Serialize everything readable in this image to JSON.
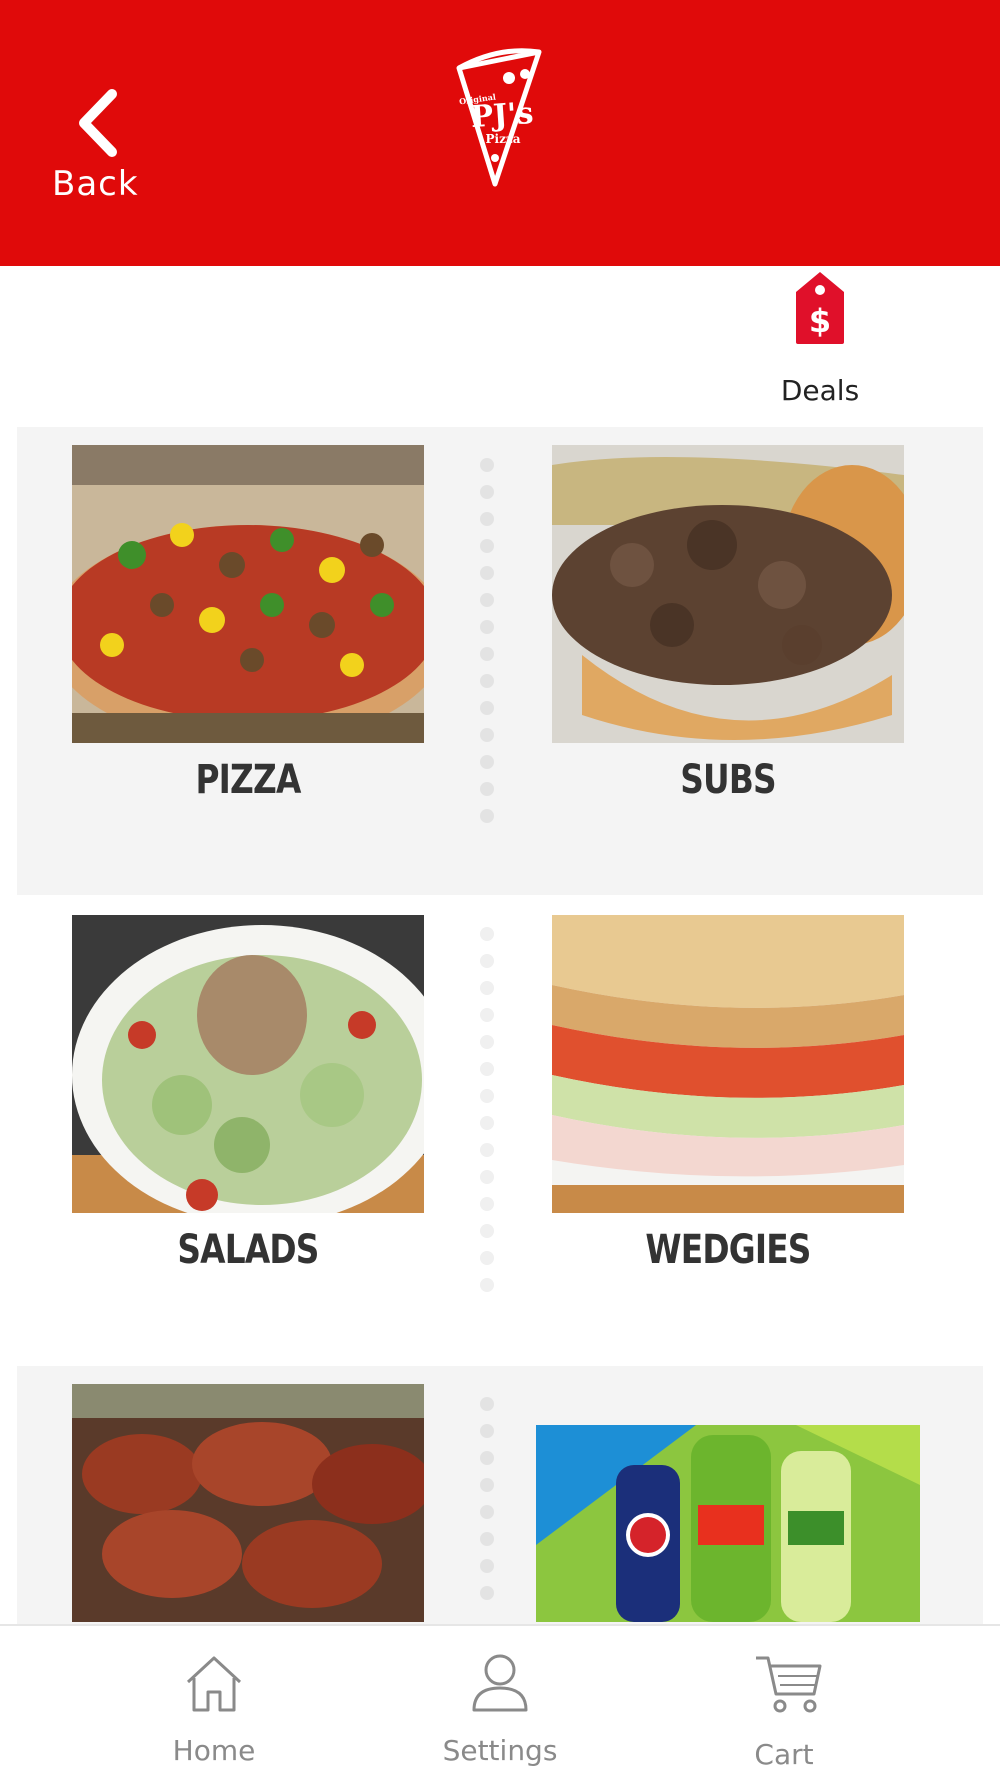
{
  "header": {
    "back_label": "Back",
    "logo": {
      "top_line": "Original",
      "main": "PJ's",
      "bottom_line": "Pizza"
    },
    "background": "#e00a0a"
  },
  "deals": {
    "label": "Deals",
    "icon": "price-tag-dollar-icon",
    "color": "#e0102a"
  },
  "categories": [
    {
      "label": "PIZZA"
    },
    {
      "label": "SUBS"
    },
    {
      "label": "SALADS"
    },
    {
      "label": "WEDGIES"
    },
    {
      "label": ""
    },
    {
      "label": ""
    }
  ],
  "bottom_nav": [
    {
      "label": "Home",
      "icon": "home-icon"
    },
    {
      "label": "Settings",
      "icon": "user-icon"
    },
    {
      "label": "Cart",
      "icon": "cart-icon"
    }
  ]
}
